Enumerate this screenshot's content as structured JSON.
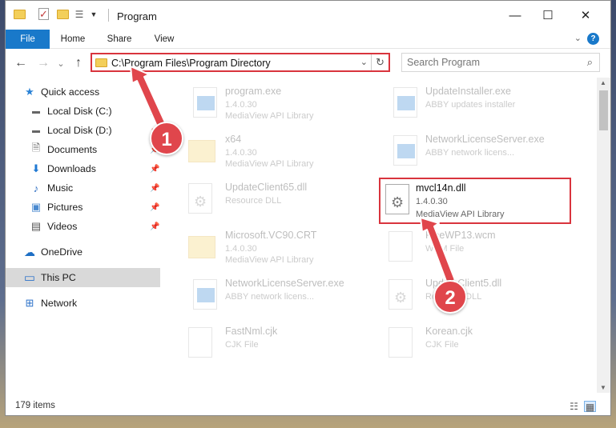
{
  "window": {
    "title": "Program",
    "minimize_glyph": "—",
    "maximize_glyph": "☐",
    "close_glyph": "✕"
  },
  "ribbon": {
    "tabs": [
      {
        "label": "File"
      },
      {
        "label": "Home"
      },
      {
        "label": "Share"
      },
      {
        "label": "View"
      }
    ],
    "help_glyph": "?"
  },
  "nav": {
    "back_glyph": "←",
    "forward_glyph": "→",
    "recent_glyph": "⌄",
    "up_glyph": "↑"
  },
  "address": {
    "path": "C:\\Program Files\\Program Directory",
    "dropdown_glyph": "⌄",
    "refresh_glyph": "↻"
  },
  "search": {
    "placeholder": "Search Program",
    "icon_glyph": "⌕"
  },
  "sidebar": {
    "items": [
      {
        "label": "Quick access",
        "icon": "star-icon",
        "glyph": "★",
        "pinned": false
      },
      {
        "label": "Local Disk (C:)",
        "icon": "drive-icon",
        "glyph": "▬",
        "pinned": true
      },
      {
        "label": "Local Disk (D:)",
        "icon": "drive-icon",
        "glyph": "▬",
        "pinned": true
      },
      {
        "label": "Documents",
        "icon": "documents-icon",
        "glyph": "🗎",
        "pinned": true
      },
      {
        "label": "Downloads",
        "icon": "downloads-icon",
        "glyph": "⬇",
        "pinned": true
      },
      {
        "label": "Music",
        "icon": "music-icon",
        "glyph": "♪",
        "pinned": true
      },
      {
        "label": "Pictures",
        "icon": "pictures-icon",
        "glyph": "▣",
        "pinned": true
      },
      {
        "label": "Videos",
        "icon": "videos-icon",
        "glyph": "▤",
        "pinned": true
      },
      {
        "label": "OneDrive",
        "icon": "cloud-icon",
        "glyph": "☁",
        "pinned": false
      },
      {
        "label": "This PC",
        "icon": "computer-icon",
        "glyph": "▭",
        "pinned": false,
        "selected": true
      },
      {
        "label": "Network",
        "icon": "network-icon",
        "glyph": "⊞",
        "pinned": false
      }
    ],
    "pin_glyph": "📌"
  },
  "files": [
    {
      "name": "program.exe",
      "line1": "1.4.0.30",
      "line2": "MediaView API Library",
      "icon": "application-icon"
    },
    {
      "name": "UpdateInstaller.exe",
      "line1": "ABBY updates installer",
      "line2": "",
      "icon": "application-icon"
    },
    {
      "name": "x64",
      "line1": "1.4.0.30",
      "line2": "MediaView API Library",
      "icon": "folder-icon"
    },
    {
      "name": "NetworkLicenseServer.exe",
      "line1": "ABBY network licens...",
      "line2": "",
      "icon": "application-icon"
    },
    {
      "name": "UpdateClient65.dll",
      "line1": "Resource DLL",
      "line2": "",
      "icon": "dll-icon"
    },
    {
      "name": "mvcl14n.dll",
      "line1": "1.4.0.30",
      "line2": "MediaView API Library",
      "icon": "dll-icon",
      "highlighted": true
    },
    {
      "name": "Microsoft.VC90.CRT",
      "line1": "1.4.0.30",
      "line2": "MediaView API Library",
      "icon": "folder-icon"
    },
    {
      "name": "FineWP13.wcm",
      "line1": "WCM File",
      "line2": "",
      "icon": "file-icon"
    },
    {
      "name": "NetworkLicenseServer.exe",
      "line1": "ABBY network licens...",
      "line2": "",
      "icon": "application-icon"
    },
    {
      "name": "UpdateClient5.dll",
      "line1": "Resource DLL",
      "line2": "",
      "icon": "dll-icon"
    },
    {
      "name": "FastNml.cjk",
      "line1": "CJK File",
      "line2": "",
      "icon": "file-icon"
    },
    {
      "name": "Korean.cjk",
      "line1": "CJK File",
      "line2": "",
      "icon": "file-icon"
    }
  ],
  "status": {
    "item_count": "179 items"
  },
  "annotations": {
    "step1": "1",
    "step2": "2",
    "arrow_color": "#e0464c"
  }
}
